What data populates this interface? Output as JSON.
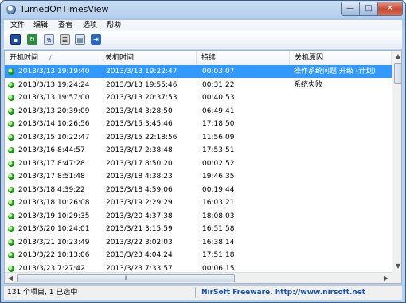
{
  "window": {
    "title": "TurnedOnTimesView"
  },
  "window_controls": {
    "minimize": "—",
    "maximize": "□",
    "close": "✕"
  },
  "menu": [
    "文件",
    "编辑",
    "查看",
    "选项",
    "帮助"
  ],
  "toolbar": {
    "buttons": [
      {
        "name": "save",
        "icon": "save-icon",
        "glyph": "▪"
      },
      {
        "name": "refresh",
        "icon": "refresh-icon",
        "glyph": "↻"
      },
      {
        "name": "copy",
        "icon": "copy-icon",
        "glyph": "⧉"
      },
      {
        "name": "properties",
        "icon": "properties-icon",
        "glyph": "☰"
      },
      {
        "name": "html-report",
        "icon": "report-icon",
        "glyph": "▤"
      },
      {
        "name": "exit",
        "icon": "exit-icon",
        "glyph": "⇥"
      }
    ]
  },
  "table": {
    "columns": [
      "开机时间",
      "关机时间",
      "持续",
      "关机原因"
    ],
    "sort_indicator": "/",
    "rows": [
      {
        "on": "2013/3/13 19:19:40",
        "off": "2013/3/13 19:22:47",
        "dur": "00:03:07",
        "reason": "操作系统问题 升级 (计划)",
        "selected": true
      },
      {
        "on": "2013/3/13 19:24:24",
        "off": "2013/3/13 19:55:46",
        "dur": "00:31:22",
        "reason": "系统失败"
      },
      {
        "on": "2013/3/13 19:57:00",
        "off": "2013/3/13 20:37:53",
        "dur": "00:40:53",
        "reason": ""
      },
      {
        "on": "2013/3/13 20:39:09",
        "off": "2013/3/14 3:28:50",
        "dur": "06:49:41",
        "reason": ""
      },
      {
        "on": "2013/3/14 10:26:56",
        "off": "2013/3/15 3:45:46",
        "dur": "17:18:50",
        "reason": ""
      },
      {
        "on": "2013/3/15 10:22:47",
        "off": "2013/3/15 22:18:56",
        "dur": "11:56:09",
        "reason": ""
      },
      {
        "on": "2013/3/16 8:44:57",
        "off": "2013/3/17 2:38:48",
        "dur": "17:53:51",
        "reason": ""
      },
      {
        "on": "2013/3/17 8:47:28",
        "off": "2013/3/17 8:50:20",
        "dur": "00:02:52",
        "reason": ""
      },
      {
        "on": "2013/3/17 8:51:48",
        "off": "2013/3/18 4:38:23",
        "dur": "19:46:35",
        "reason": ""
      },
      {
        "on": "2013/3/18 4:39:22",
        "off": "2013/3/18 4:59:06",
        "dur": "00:19:44",
        "reason": ""
      },
      {
        "on": "2013/3/18 10:26:08",
        "off": "2013/3/19 2:29:29",
        "dur": "16:03:21",
        "reason": ""
      },
      {
        "on": "2013/3/19 10:29:35",
        "off": "2013/3/20 4:37:38",
        "dur": "18:08:03",
        "reason": ""
      },
      {
        "on": "2013/3/20 10:24:01",
        "off": "2013/3/21 3:15:59",
        "dur": "16:51:58",
        "reason": ""
      },
      {
        "on": "2013/3/21 10:23:49",
        "off": "2013/3/22 3:02:03",
        "dur": "16:38:14",
        "reason": ""
      },
      {
        "on": "2013/3/22 10:13:06",
        "off": "2013/3/23 4:04:24",
        "dur": "17:51:18",
        "reason": ""
      },
      {
        "on": "2013/3/23 7:27:42",
        "off": "2013/3/23 7:33:57",
        "dur": "00:06:15",
        "reason": ""
      }
    ]
  },
  "scrollbars": {
    "up": "▲",
    "down": "▼",
    "left": "◀",
    "right": "▶",
    "grip": "⦀"
  },
  "status": {
    "count": "131 个项目, 1 已选中",
    "credit": "NirSoft Freeware.  http://www.nirsoft.net"
  }
}
